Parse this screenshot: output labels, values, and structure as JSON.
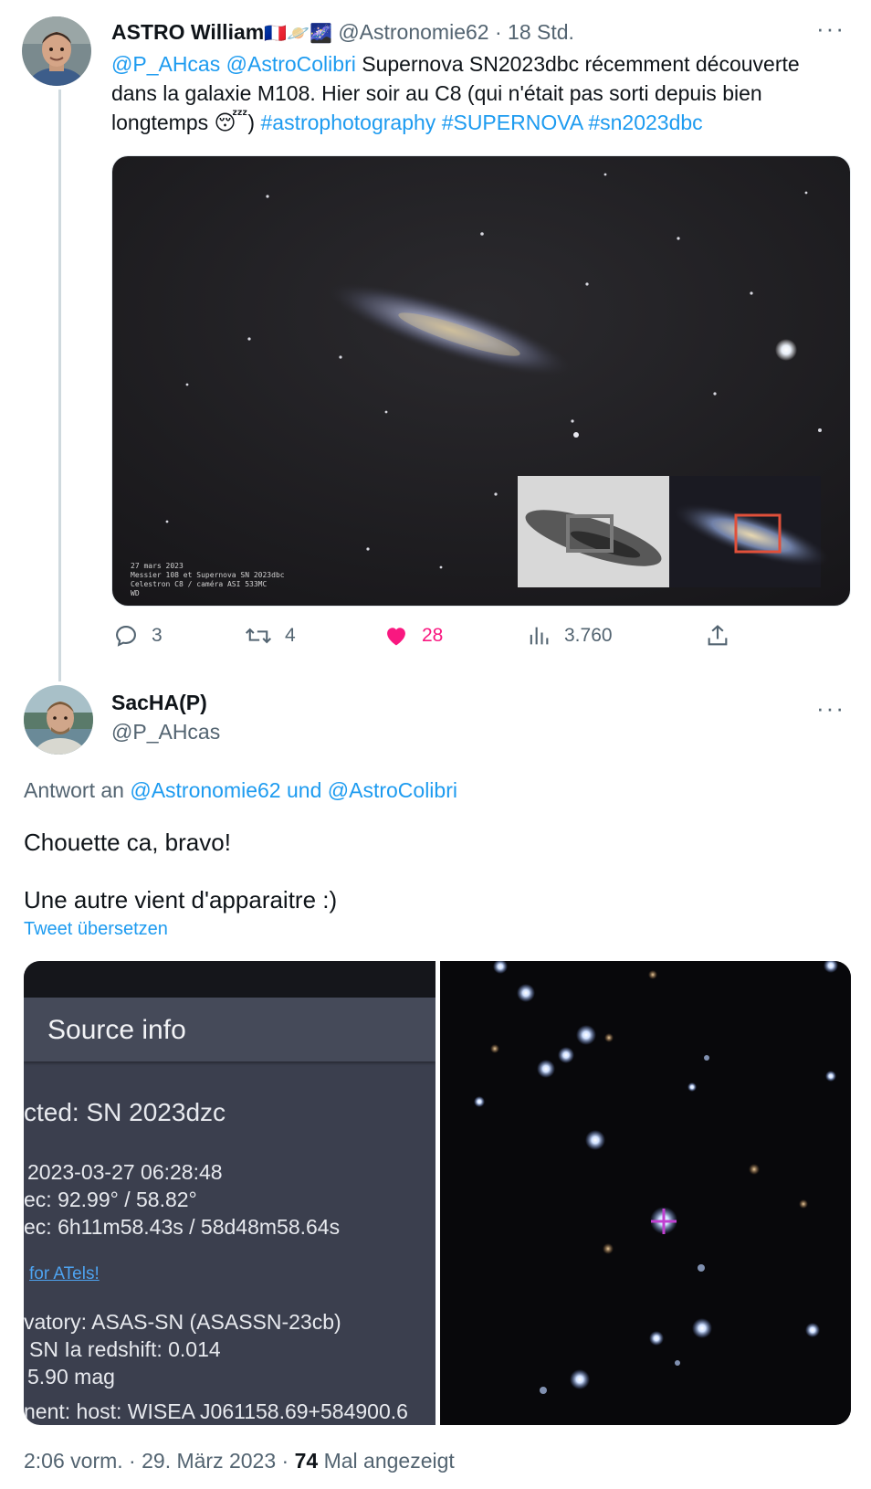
{
  "tweet1": {
    "display_name": "ASTRO William",
    "name_emojis": "🇫🇷🪐🌌",
    "handle": "@Astronomie62",
    "separator": "·",
    "time": "18 Std.",
    "more": "···",
    "text": {
      "mention1": "@P_AHcas",
      "mention2": "@AstroColibri",
      "body": "Supernova SN2023dbc récemment découverte dans la galaxie M108. Hier soir au C8 (qui n'était pas sorti depuis bien longtemps",
      "emoji": "😴",
      "close_paren": ")",
      "hashtag1": "#astrophotography",
      "hashtag2": "#SUPERNOVA",
      "hashtag3": "#sn2023dbc"
    },
    "image_caption": [
      "27 mars 2023",
      "Messier 108 et Supernova SN 2023dbc",
      "Celestron C8 / caméra ASI 533MC",
      "WD"
    ],
    "actions": {
      "replies": "3",
      "retweets": "4",
      "likes": "28",
      "views": "3.760"
    }
  },
  "tweet2": {
    "display_name": "SacHA(P)",
    "handle": "@P_AHcas",
    "more": "···",
    "reply_prefix": "Antwort an",
    "reply_mention1": "@Astronomie62",
    "reply_and": "und",
    "reply_mention2": "@AstroColibri",
    "body_line1": "Chouette ca, bravo!",
    "body_line2": "Une autre vient d'apparaitre :)",
    "translate": "Tweet übersetzen",
    "source_panel": {
      "title": "Source info",
      "detected": "cted: SN 2023dzc",
      "date": "2023-03-27 06:28:48",
      "radec_deg": "ec: 92.99° / 58.82°",
      "radec_hms": "ec: 6h11m58.43s / 58d48m58.64s",
      "atels": "for ATels!",
      "observatory": "vatory: ASAS-SN     (ASASSN-23cb)",
      "type": "SN Ia    redshift: 0.014",
      "mag": "5.90 mag",
      "host": "nent: host: WISEA J061158.69+584900.6"
    },
    "footer": {
      "time": "2:06 vorm.",
      "sep1": "·",
      "date": "29. März 2023",
      "sep2": "·",
      "views": "74",
      "views_label": "Mal angezeigt"
    }
  },
  "colors": {
    "link": "#1d9bf0",
    "muted": "#536471",
    "like": "#f91880",
    "text": "#0f1419"
  }
}
